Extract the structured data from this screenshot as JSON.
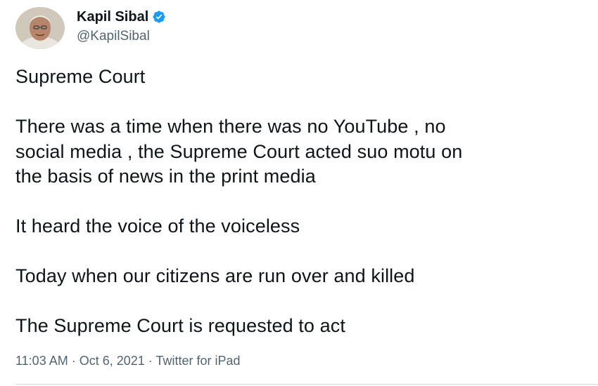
{
  "author": {
    "display_name": "Kapil Sibal",
    "handle": "@KapilSibal",
    "verified": true,
    "verified_color": "#1d9bf0"
  },
  "tweet": {
    "paragraphs": [
      "Supreme Court",
      "There was a time when there was no YouTube , no\nsocial media , the Supreme Court acted suo motu on\nthe basis of news in the print media",
      "It heard the voice of the voiceless",
      "Today when our citizens are run over and killed",
      "The Supreme Court is requested to act"
    ]
  },
  "meta": {
    "time": "11:03 AM",
    "separator": " · ",
    "date": "Oct 6, 2021",
    "source": "Twitter for iPad"
  },
  "colors": {
    "text": "#0f1419",
    "secondary_text": "#536471",
    "divider": "#cfd9de"
  },
  "icons": {
    "verified": "verified-badge-icon",
    "avatar": "profile-photo"
  }
}
